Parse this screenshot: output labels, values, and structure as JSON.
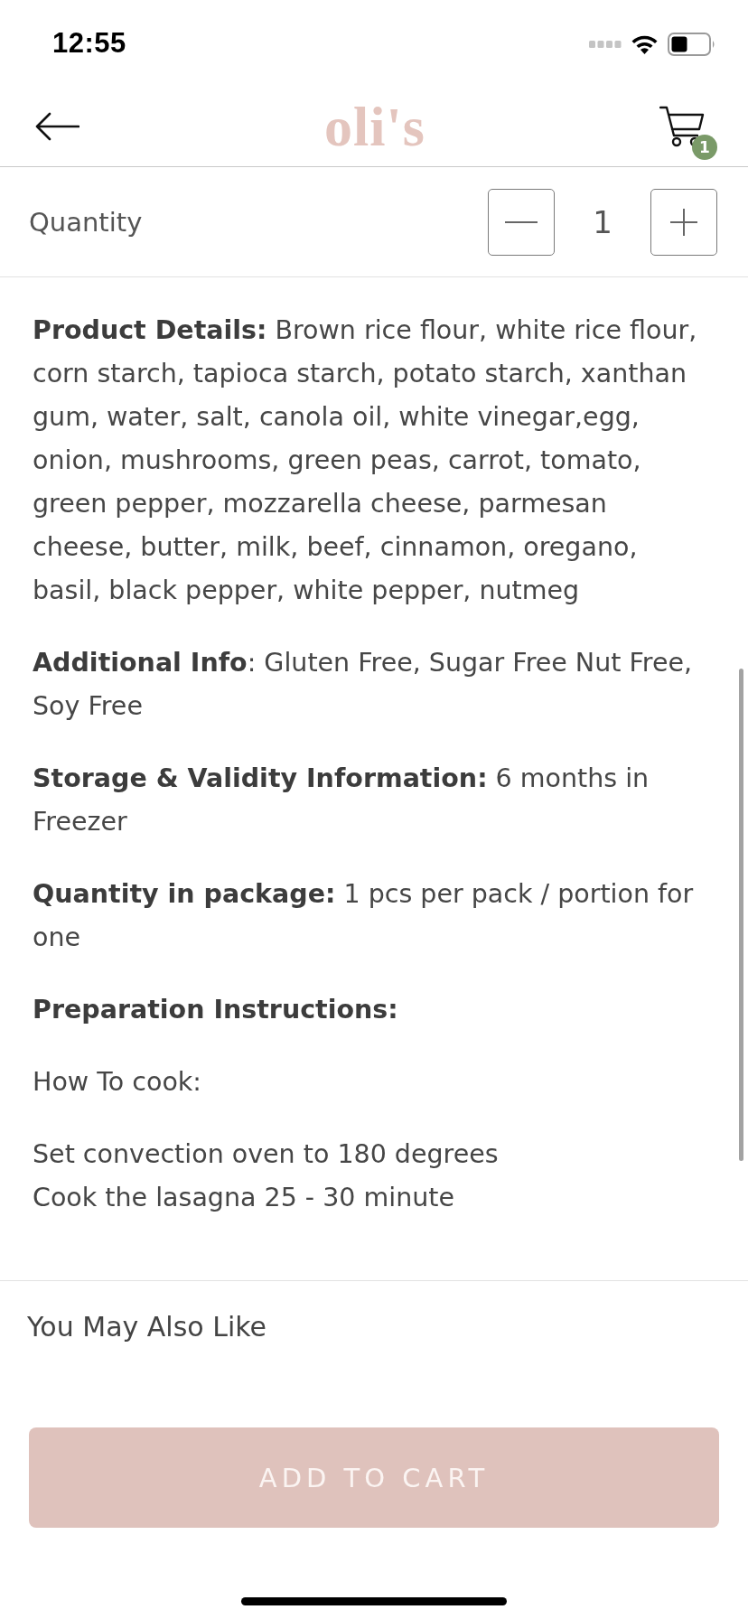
{
  "status_bar": {
    "time": "12:55"
  },
  "header": {
    "logo": "oli's",
    "cart_count": "1"
  },
  "quantity": {
    "label": "Quantity",
    "value": "1"
  },
  "details": [
    {
      "kind": "rich",
      "text": "**Product Details:** Brown rice flour, white rice flour, corn starch, tapioca starch, potato starch, xanthan gum, water, salt, canola oil, white vinegar,egg, onion, mushrooms, green peas, carrot, tomato, green pepper, mozzarella cheese, parmesan cheese, butter, milk, beef, cinnamon, oregano, basil, black pepper, white pepper, nutmeg"
    },
    {
      "kind": "rich",
      "text": "**Additional Info**: Gluten Free, Sugar Free Nut Free, Soy Free"
    },
    {
      "kind": "rich",
      "text": "**Storage & Validity Information:** 6 months in Freezer"
    },
    {
      "kind": "rich",
      "text": "**Quantity in package:** 1 pcs per pack / portion for one"
    },
    {
      "kind": "heading",
      "text": "Preparation Instructions:"
    },
    {
      "kind": "plain",
      "text": "How To cook:"
    },
    {
      "kind": "lines",
      "lines": [
        "Set convection oven to 180 degrees",
        "Cook the lasagna 25 - 30 minute"
      ]
    }
  ],
  "related": {
    "title": "You May Also Like"
  },
  "cart_button": {
    "label": "ADD TO CART"
  }
}
